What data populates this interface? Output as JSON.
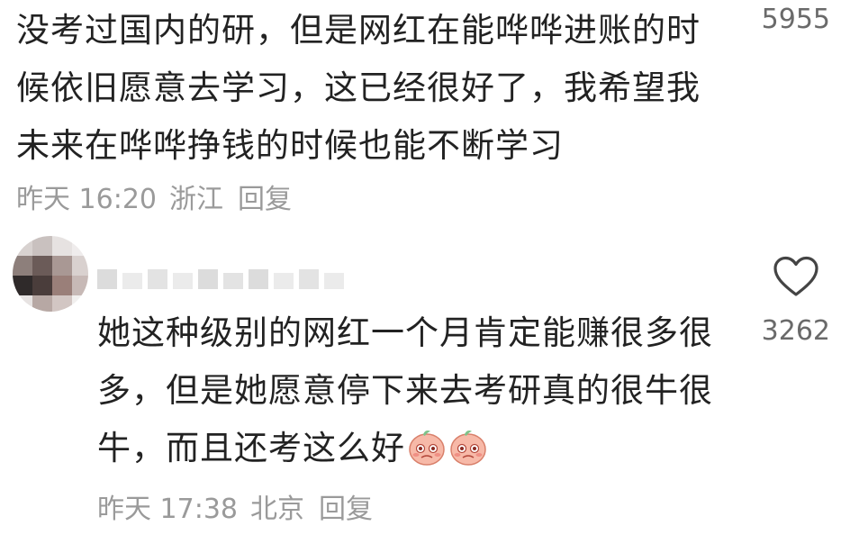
{
  "comments": [
    {
      "text": "没考过国内的研，但是网红在能哗哗进账的时候依旧愿意去学习，这已经很好了，我希望我未来在哗哗挣钱的时候也能不断学习",
      "likes": "5955",
      "time": "昨天 16:20",
      "location": "浙江",
      "reply_label": "回复"
    },
    {
      "text": "她这种级别的网红一个月肯定能赚很多很多，但是她愿意停下来去考研真的很牛很牛，而且还考这么好",
      "emojis": [
        "peach-emoji-icon",
        "peach-emoji-icon"
      ],
      "likes": "3262",
      "time": "昨天 17:38",
      "location": "北京",
      "reply_label": "回复",
      "like_icon": "heart-outline-icon"
    }
  ]
}
